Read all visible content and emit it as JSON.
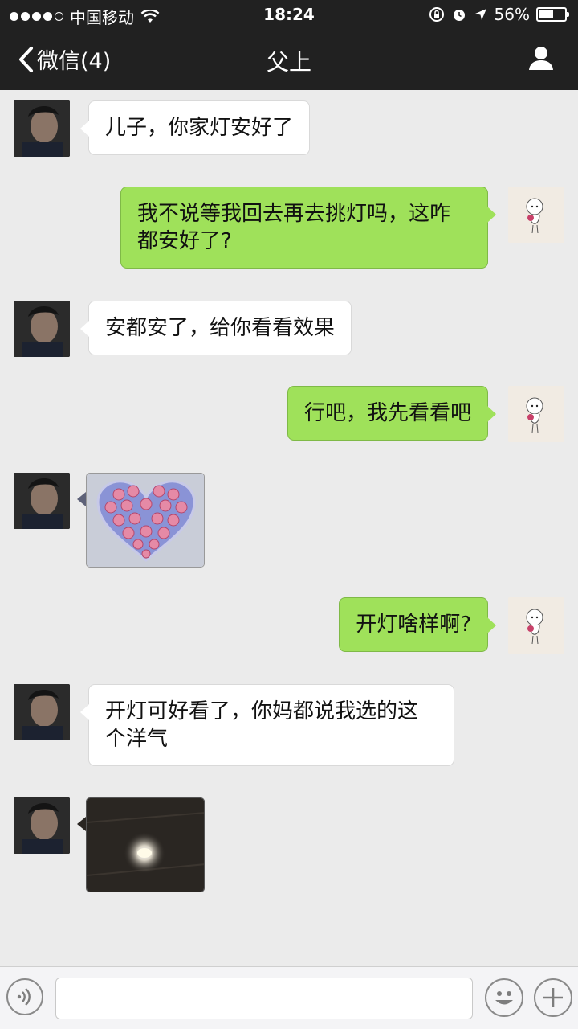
{
  "status_bar": {
    "carrier": "中国移动",
    "time": "18:24",
    "battery_text": "56%",
    "battery_level": 0.56,
    "signal_bars": 4
  },
  "nav": {
    "back_label": "微信(4)",
    "title": "父上",
    "icons": {
      "back": "chevron-left-icon",
      "profile": "person-icon"
    }
  },
  "messages": [
    {
      "sender": "father",
      "type": "text",
      "text": "儿子，你家灯安好了"
    },
    {
      "sender": "me",
      "type": "text",
      "lines": [
        "我不说等我回去再去挑灯吗，这咋",
        "都安好了?"
      ]
    },
    {
      "sender": "father",
      "type": "text",
      "text": "安都安了，给你看看效果"
    },
    {
      "sender": "me",
      "type": "text",
      "text": "行吧，我先看看吧"
    },
    {
      "sender": "father",
      "type": "image",
      "image": "heart-shaped-rose-lamp"
    },
    {
      "sender": "me",
      "type": "text",
      "text": "开灯啥样啊?"
    },
    {
      "sender": "father",
      "type": "text",
      "lines": [
        "开灯可好看了，你妈都说我选的这",
        "个洋气"
      ]
    },
    {
      "sender": "father",
      "type": "image",
      "image": "lit-ceiling-lamp"
    }
  ],
  "input_bar": {
    "icons": {
      "voice": "voice-icon",
      "emoji": "emoji-icon",
      "more": "plus-icon"
    },
    "text_value": ""
  },
  "colors": {
    "bar_bg": "#212121",
    "chat_bg": "#ebebeb",
    "my_bubble": "#9fe15a",
    "their_bubble": "#ffffff"
  }
}
